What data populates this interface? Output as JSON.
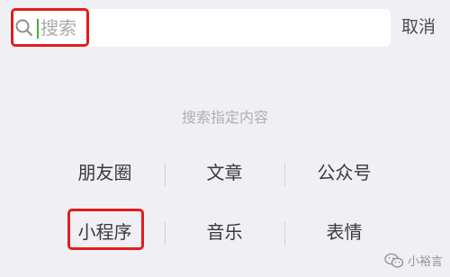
{
  "search": {
    "placeholder": "搜索",
    "value": ""
  },
  "cancel_label": "取消",
  "section_hint": "搜索指定内容",
  "categories": [
    [
      "朋友圈",
      "文章",
      "公众号"
    ],
    [
      "小程序",
      "音乐",
      "表情"
    ]
  ],
  "watermark": {
    "text": "小裕言"
  },
  "colors": {
    "background": "#efeff4",
    "highlight": "#e31c1c",
    "caret": "#3cb034"
  },
  "icons": {
    "search": "search-icon",
    "watermark": "wechat-account-icon"
  }
}
